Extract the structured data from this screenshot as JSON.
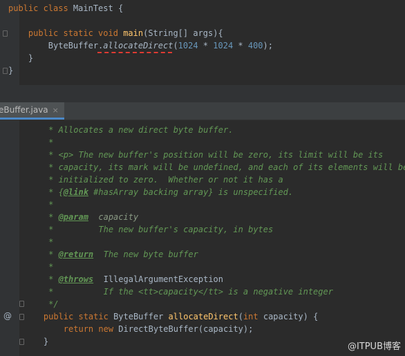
{
  "top": {
    "lines": [
      {
        "parts": [
          [
            "kw",
            "public class "
          ],
          [
            "",
            "MainTest {"
          ]
        ]
      },
      {
        "parts": [
          [
            "",
            ""
          ]
        ]
      },
      {
        "parts": [
          [
            "",
            "    "
          ],
          [
            "kw",
            "public static void "
          ],
          [
            "fn",
            "main"
          ],
          [
            "",
            "(String[] args){"
          ]
        ]
      },
      {
        "parts": [
          [
            "",
            "        ByteBuffer."
          ],
          [
            "static-call",
            "allocateDirect"
          ],
          [
            "",
            "("
          ],
          [
            "num",
            "1024"
          ],
          [
            "",
            " * "
          ],
          [
            "num",
            "1024"
          ],
          [
            "",
            " * "
          ],
          [
            "num",
            "400"
          ],
          [
            "",
            ");"
          ]
        ]
      },
      {
        "parts": [
          [
            "",
            "    }"
          ]
        ]
      },
      {
        "parts": [
          [
            "",
            "}"
          ]
        ]
      }
    ]
  },
  "tab": {
    "label": "eBuffer.java",
    "close": "×"
  },
  "bottom": {
    "lines": [
      [
        [
          "doc",
          "     * Allocates a new direct byte buffer."
        ]
      ],
      [
        [
          "doc",
          "     *"
        ]
      ],
      [
        [
          "doc",
          "     * "
        ],
        [
          "html",
          "<p>"
        ],
        [
          "doc",
          " The new buffer's position will be zero, its limit will be its"
        ]
      ],
      [
        [
          "doc",
          "     * capacity, its mark will be undefined, and each of its elements will be"
        ]
      ],
      [
        [
          "doc",
          "     * initialized to zero.  Whether or not it has a"
        ]
      ],
      [
        [
          "doc",
          "     * {"
        ],
        [
          "tag",
          "@link"
        ],
        [
          "doc",
          " #hasArray backing array} is unspecified."
        ]
      ],
      [
        [
          "doc",
          "     *"
        ]
      ],
      [
        [
          "doc",
          "     * "
        ],
        [
          "tag",
          "@param"
        ],
        [
          "doc-ref",
          "  capacity"
        ]
      ],
      [
        [
          "doc",
          "     *         The new buffer's capacity, in bytes"
        ]
      ],
      [
        [
          "doc",
          "     *"
        ]
      ],
      [
        [
          "doc",
          "     * "
        ],
        [
          "tag",
          "@return"
        ],
        [
          "doc",
          "  The new byte buffer"
        ]
      ],
      [
        [
          "doc",
          "     *"
        ]
      ],
      [
        [
          "doc",
          "     * "
        ],
        [
          "tag",
          "@throws"
        ],
        [
          "",
          "  IllegalArgumentException"
        ]
      ],
      [
        [
          "doc",
          "     *          If the "
        ],
        [
          "html",
          "<tt>"
        ],
        [
          "doc",
          "capacity"
        ],
        [
          "html",
          "</tt>"
        ],
        [
          "doc",
          " is a negative integer"
        ]
      ],
      [
        [
          "doc",
          "     */"
        ]
      ],
      [
        [
          "",
          "    "
        ],
        [
          "kw",
          "public static "
        ],
        [
          "",
          "ByteBuffer "
        ],
        [
          "fn",
          "allocateDirect"
        ],
        [
          "",
          "("
        ],
        [
          "kw",
          "int "
        ],
        [
          "",
          "capacity) {"
        ]
      ],
      [
        [
          "",
          "        "
        ],
        [
          "kw",
          "return new "
        ],
        [
          "",
          "DirectByteBuffer(capacity);"
        ]
      ],
      [
        [
          "",
          "    }"
        ]
      ]
    ]
  },
  "gutter_marker": "@",
  "watermark": "@ITPUB博客"
}
